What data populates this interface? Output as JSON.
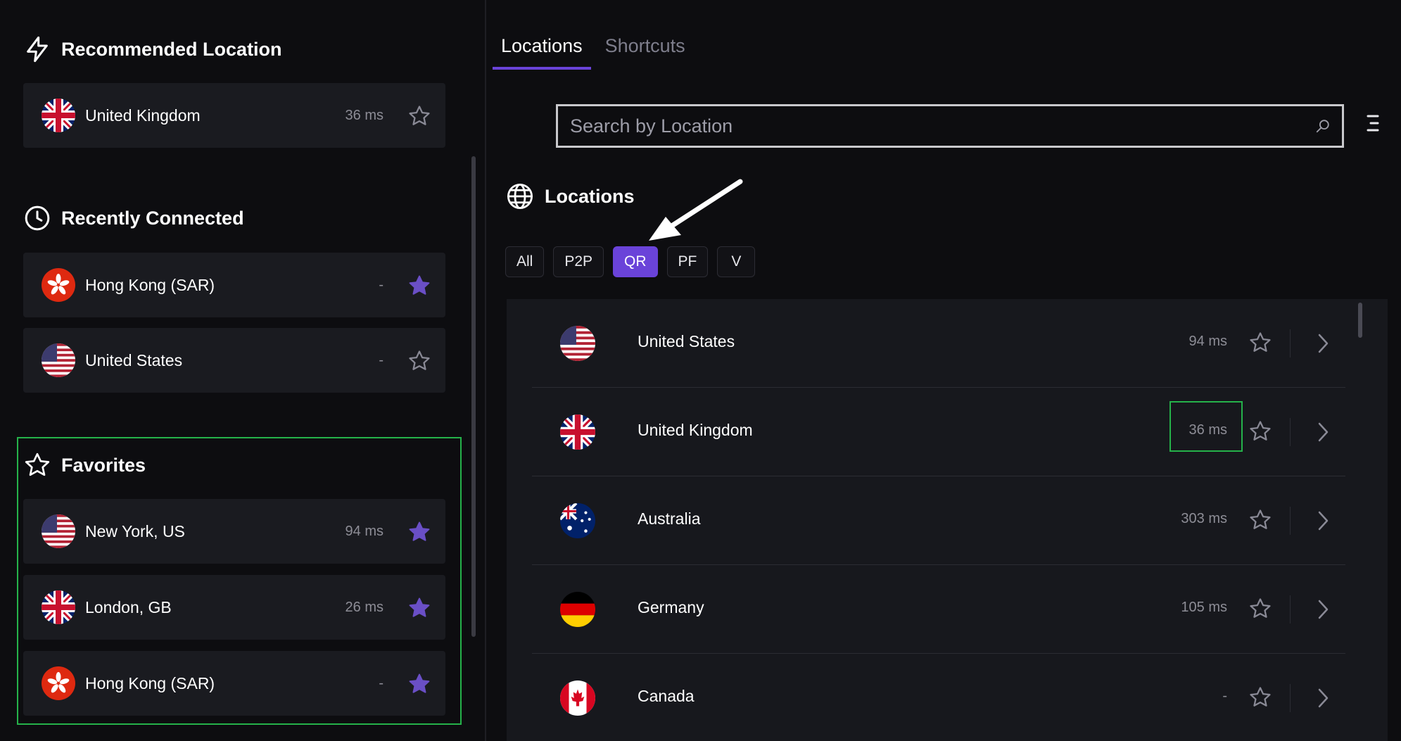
{
  "recommended": {
    "title": "Recommended Location",
    "item": {
      "name": "United Kingdom",
      "ping": "36 ms",
      "flag": "uk-flag",
      "favorited": false
    }
  },
  "recent": {
    "title": "Recently Connected",
    "items": [
      {
        "name": "Hong Kong (SAR)",
        "ping": "-",
        "flag": "hk-flag",
        "favorited": true
      },
      {
        "name": "United States",
        "ping": "-",
        "flag": "us-flag",
        "favorited": false
      }
    ]
  },
  "favorites": {
    "title": "Favorites",
    "items": [
      {
        "name": "New York, US",
        "ping": "94 ms",
        "flag": "us-flag",
        "favorited": true
      },
      {
        "name": "London, GB",
        "ping": "26 ms",
        "flag": "uk-flag",
        "favorited": true
      },
      {
        "name": "Hong Kong (SAR)",
        "ping": "-",
        "flag": "hk-flag",
        "favorited": true
      }
    ]
  },
  "tabs": [
    {
      "label": "Locations",
      "active": true
    },
    {
      "label": "Shortcuts",
      "active": false
    }
  ],
  "search": {
    "placeholder": "Search by Location",
    "value": ""
  },
  "locations": {
    "title": "Locations",
    "filters": [
      {
        "label": "All",
        "active": false
      },
      {
        "label": "P2P",
        "active": false
      },
      {
        "label": "QR",
        "active": true
      },
      {
        "label": "PF",
        "active": false
      },
      {
        "label": "V",
        "active": false
      }
    ],
    "items": [
      {
        "name": "United States",
        "ping": "94 ms",
        "flag": "us-flag"
      },
      {
        "name": "United Kingdom",
        "ping": "36 ms",
        "flag": "uk-flag"
      },
      {
        "name": "Australia",
        "ping": "303 ms",
        "flag": "au-flag"
      },
      {
        "name": "Germany",
        "ping": "105 ms",
        "flag": "de-flag"
      },
      {
        "name": "Canada",
        "ping": "-",
        "flag": "ca-flag"
      }
    ]
  },
  "colors": {
    "accent": "#6a43d9",
    "highlight_box": "#25b24a",
    "star_filled": "#6a4fc6",
    "row_bg": "#1a1b20",
    "background": "#0d0d10"
  }
}
